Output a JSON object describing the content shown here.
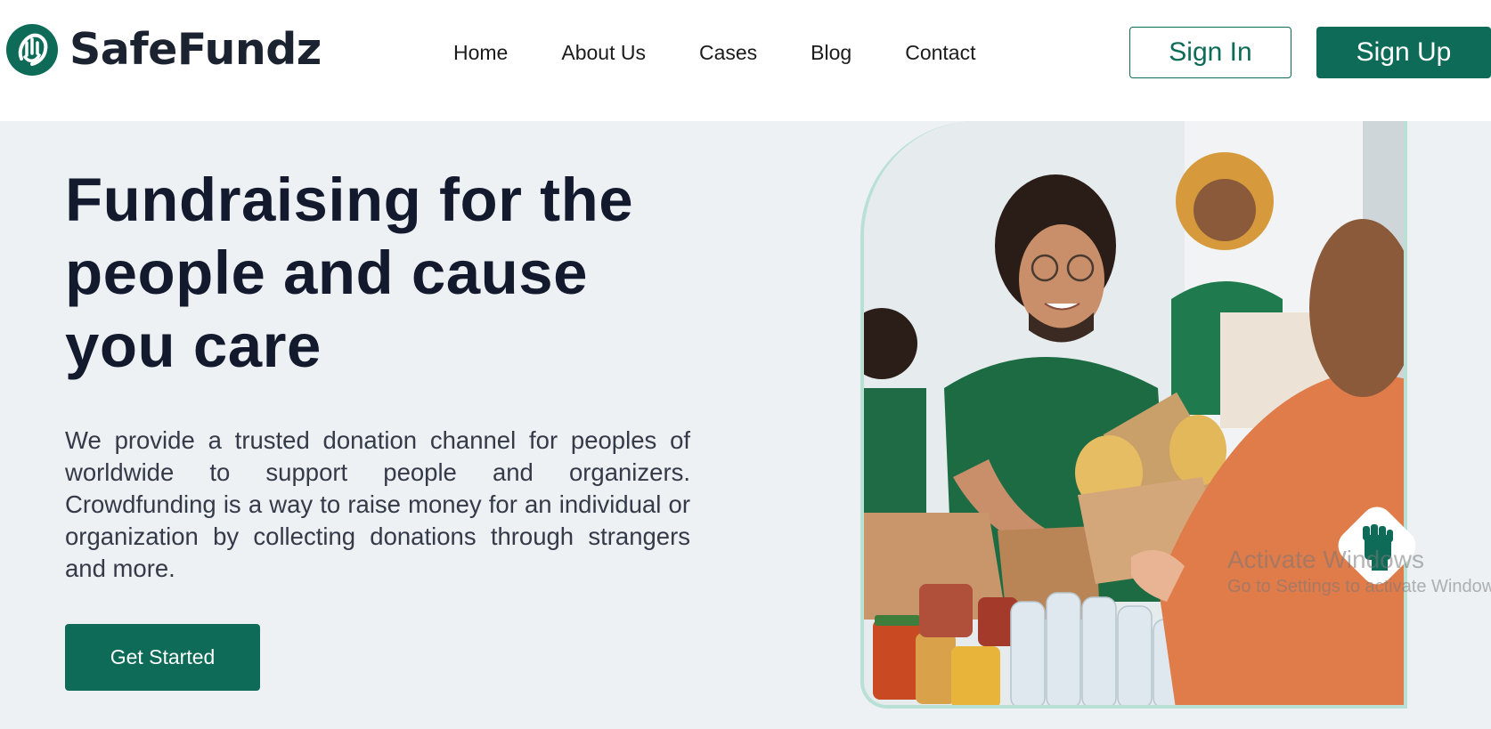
{
  "brand": {
    "name": "SafeFundz",
    "primary_color": "#0d6b57",
    "logo_icon": "raised-hand-circle-icon"
  },
  "nav": {
    "items": [
      {
        "label": "Home"
      },
      {
        "label": "About Us"
      },
      {
        "label": "Cases"
      },
      {
        "label": "Blog"
      },
      {
        "label": "Contact"
      }
    ]
  },
  "auth": {
    "sign_in_label": "Sign In",
    "sign_up_label": "Sign Up"
  },
  "hero": {
    "title": "Fundraising for the people and cause you care",
    "description": "We provide a trusted donation channel for peoples of worldwide to support people and organizers. Crowdfunding is a way to raise money for an individual or organization by collecting donations through strangers and more.",
    "cta_label": "Get Started",
    "image_alt": "Volunteers handing out food donations",
    "floating_icon": "raised-fist-icon"
  },
  "os_watermark": {
    "title": "Activate Windows",
    "subtitle": "Go to Settings to activate Windows."
  }
}
